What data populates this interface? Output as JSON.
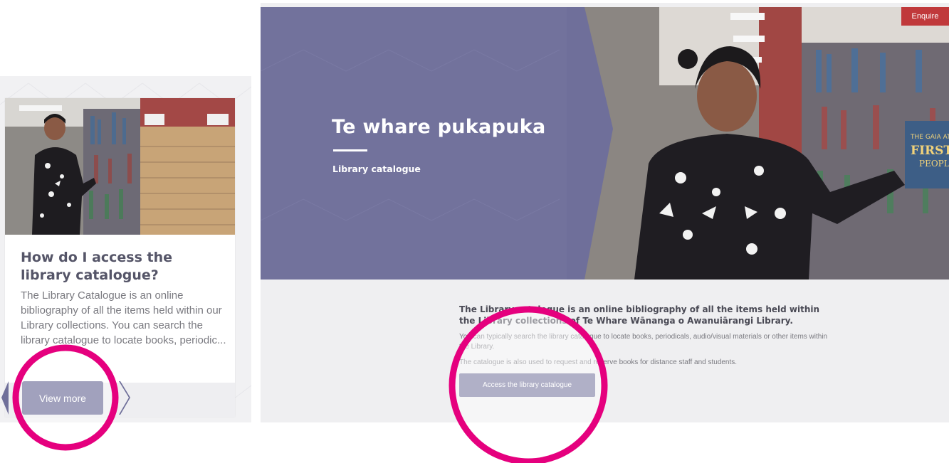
{
  "card": {
    "title": "How do I access the library catalogue?",
    "description": "The Library Catalogue is an online bibliography of all the items held within our Library collections. You can search the library catalogue to locate books, periodic...",
    "button_label": "View more",
    "photo_signs": [
      "",
      ""
    ]
  },
  "hero": {
    "title": "Te whare pukapuka",
    "subtitle": "Library catalogue",
    "enquire_label": "Enquire"
  },
  "content": {
    "lead": "The Library catalogue is an online bibliography of all the items held within the Library collections of Te Whare Wānanga o Awanuiārangi Library.",
    "paragraph1": "You can typically search the library catalogue to locate books, periodicals, audio/visual materials or other items within the Library.",
    "paragraph2": "The catalogue is also used to request and reserve books for distance staff and students.",
    "button_label": "Access the library catalogue"
  },
  "colors": {
    "accent": "#6f6f9a",
    "enquire": "#c0393b",
    "highlight_ring": "#e5007e"
  }
}
